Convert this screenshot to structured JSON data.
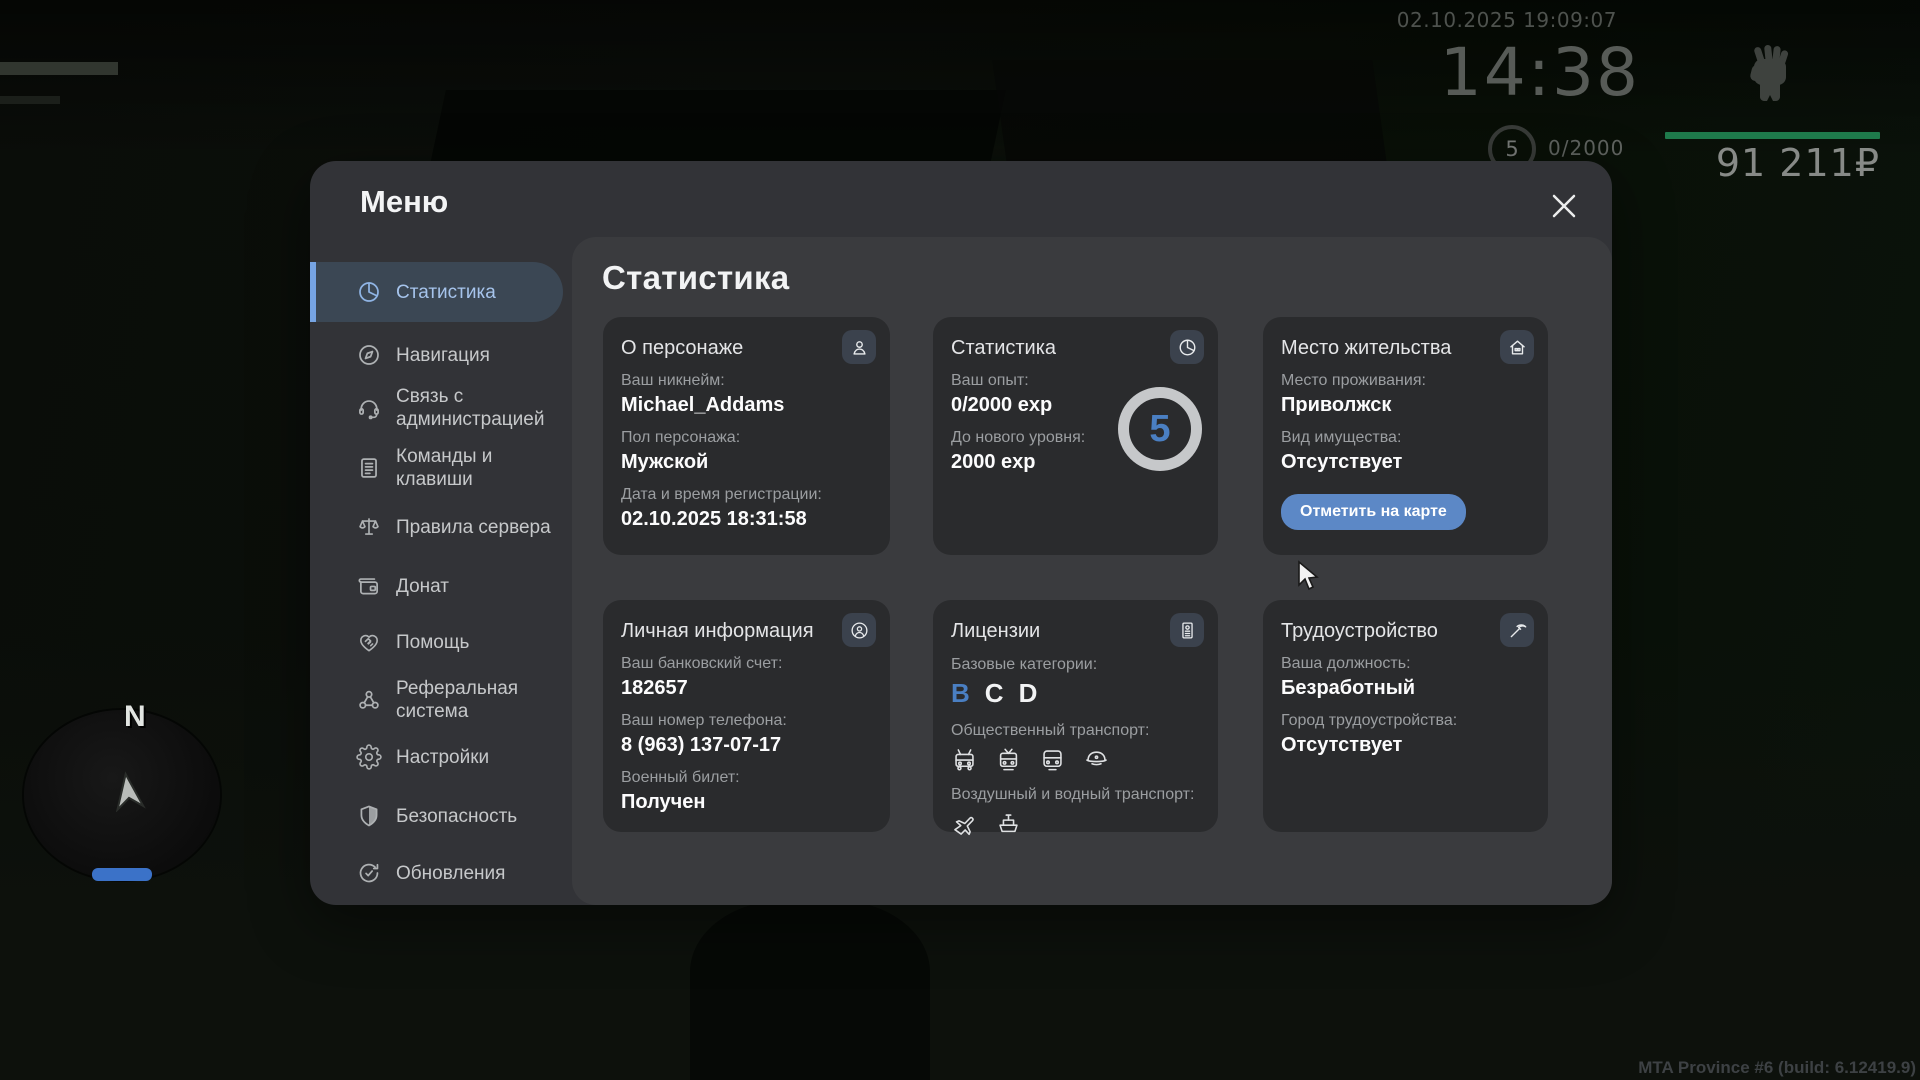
{
  "hud": {
    "datetime": "02.10.2025 19:09:07",
    "clock": "14:38",
    "level": "5",
    "exp": "0/2000",
    "money": "91 211₽",
    "build": "MTA Province #6 (build: 6.12419.9)",
    "minimap_north": "N"
  },
  "colors": {
    "accent_blue": "#6da0e0",
    "button_blue": "#5c88c6",
    "level_blue": "#4a7fc2",
    "exp_green": "#1e7a4b"
  },
  "menu": {
    "title": "Меню",
    "heading": "Статистика",
    "sidebar": [
      {
        "label": "Статистика"
      },
      {
        "label": "Навигация"
      },
      {
        "label": "Связь с администрацией"
      },
      {
        "label": "Команды и клавиши"
      },
      {
        "label": "Правила сервера"
      },
      {
        "label": "Донат"
      },
      {
        "label": "Помощь"
      },
      {
        "label": "Реферальная система"
      },
      {
        "label": "Настройки"
      },
      {
        "label": "Безопасность"
      },
      {
        "label": "Обновления"
      }
    ],
    "cards": {
      "about": {
        "title": "О персонаже",
        "fields": [
          {
            "label": "Ваш никнейм:",
            "value": "Michael_Addams"
          },
          {
            "label": "Пол персонажа:",
            "value": "Мужской"
          },
          {
            "label": "Дата и время регистрации:",
            "value": "02.10.2025 18:31:58"
          }
        ]
      },
      "stats": {
        "title": "Статистика",
        "level": "5",
        "fields": [
          {
            "label": "Ваш опыт:",
            "value": "0/2000 exp"
          },
          {
            "label": "До нового уровня:",
            "value": "2000 exp"
          }
        ]
      },
      "residence": {
        "title": "Место жительства",
        "button": "Отметить на карте",
        "fields": [
          {
            "label": "Место проживания:",
            "value": "Приволжск"
          },
          {
            "label": "Вид имущества:",
            "value": "Отсутствует"
          }
        ]
      },
      "personal": {
        "title": "Личная информация",
        "fields": [
          {
            "label": "Ваш банковский счет:",
            "value": "182657"
          },
          {
            "label": "Ваш номер телефона:",
            "value": "8 (963) 137-07-17"
          },
          {
            "label": "Военный билет:",
            "value": "Получен"
          }
        ]
      },
      "licenses": {
        "title": "Лицензии",
        "categories_label": "Базовые категории:",
        "categories": [
          "B",
          "C",
          "D"
        ],
        "public_transport_label": "Общественный транспорт:",
        "air_water_label": "Воздушный и водный транспорт:"
      },
      "job": {
        "title": "Трудоустройство",
        "fields": [
          {
            "label": "Ваша должность:",
            "value": "Безработный"
          },
          {
            "label": "Город трудоустройства:",
            "value": "Отсутствует"
          }
        ]
      }
    }
  }
}
